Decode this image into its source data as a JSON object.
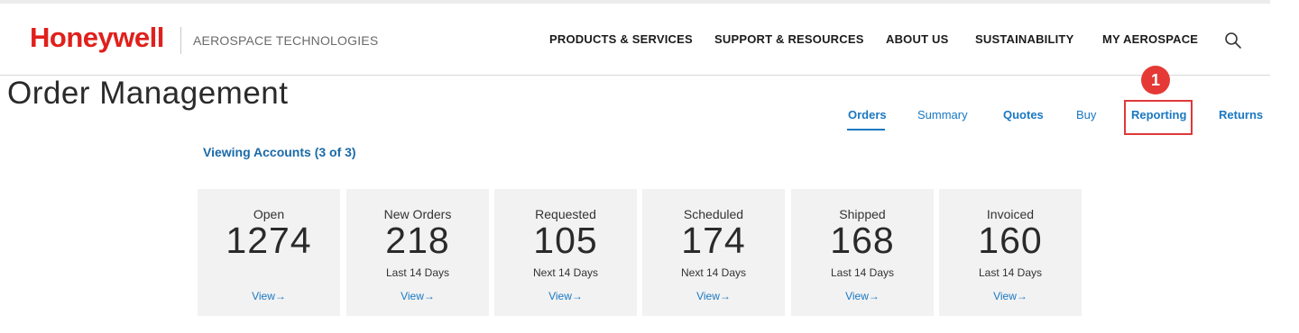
{
  "header": {
    "brand": "Honeywell",
    "division": "AEROSPACE TECHNOLOGIES",
    "nav": [
      "PRODUCTS & SERVICES",
      "SUPPORT & RESOURCES",
      "ABOUT US",
      "SUSTAINABILITY",
      "MY AEROSPACE"
    ],
    "search_icon": "search-icon"
  },
  "page": {
    "title": "Order Management",
    "viewing_accounts": "Viewing Accounts (3 of 3)"
  },
  "tabs": [
    {
      "label": "Orders",
      "active": true
    },
    {
      "label": "Summary",
      "active": false
    },
    {
      "label": "Quotes",
      "active": false
    },
    {
      "label": "Buy",
      "active": false
    },
    {
      "label": "Reporting",
      "active": false
    },
    {
      "label": "Returns",
      "active": false
    }
  ],
  "annotation": {
    "step": "1"
  },
  "cards": [
    {
      "label": "Open",
      "value": "1274",
      "period": "",
      "link": "View→"
    },
    {
      "label": "New Orders",
      "value": "218",
      "period": "Last 14 Days",
      "link": "View→"
    },
    {
      "label": "Requested",
      "value": "105",
      "period": "Next 14 Days",
      "link": "View→"
    },
    {
      "label": "Scheduled",
      "value": "174",
      "period": "Next 14 Days",
      "link": "View→"
    },
    {
      "label": "Shipped",
      "value": "168",
      "period": "Last 14 Days",
      "link": "View→"
    },
    {
      "label": "Invoiced",
      "value": "160",
      "period": "Last 14 Days",
      "link": "View→"
    }
  ],
  "colors": {
    "brand": "#e0201c",
    "link": "#1a78c2",
    "annotation": "#e53935"
  }
}
